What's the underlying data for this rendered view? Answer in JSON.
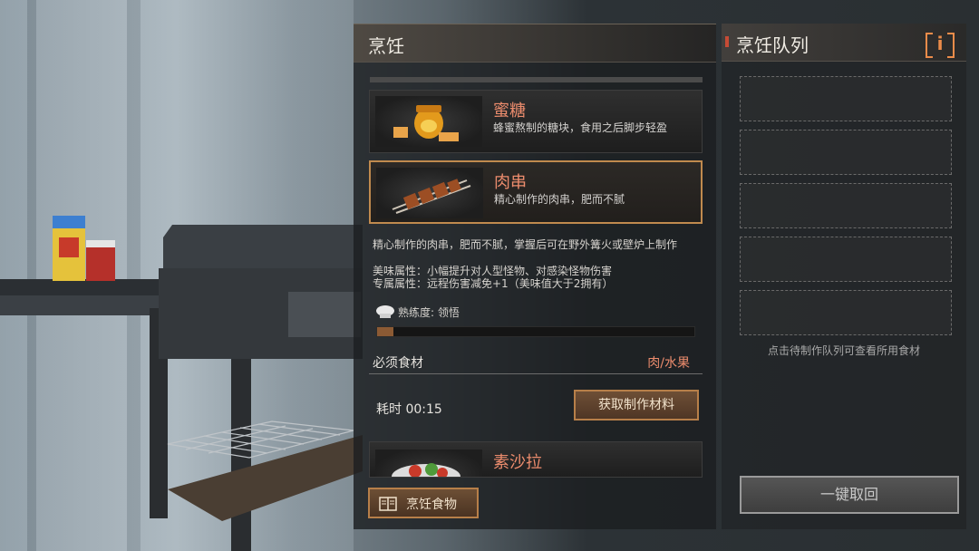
{
  "cooking": {
    "title": "烹饪",
    "recipes": [
      {
        "name": "蜜糖",
        "desc": "蜂蜜熬制的糖块，食用之后脚步轻盈",
        "icon": "honey-jar-icon"
      },
      {
        "name": "肉串",
        "desc": "精心制作的肉串，肥而不腻",
        "icon": "meat-skewer-icon",
        "selected": true
      },
      {
        "name": "素沙拉",
        "desc": "",
        "icon": "salad-bowl-icon"
      }
    ],
    "detail": {
      "long_desc": "精心制作的肉串，肥而不腻，掌握后可在野外篝火或壁炉上制作",
      "attr1": "美味属性：小幅提升对人型怪物、对感染怪物伤害",
      "attr2": "专属属性：远程伤害减免+1（美味值大于2拥有）",
      "proficiency": "熟练度: 领悟",
      "proficiency_progress": 0.05,
      "required_label": "必须食材",
      "required_value": "肉/水果",
      "time": "耗时 00:15",
      "get_button": "获取制作材料"
    },
    "cook_button": "烹饪食物"
  },
  "queue": {
    "title": "烹饪队列",
    "info_label": "i",
    "hint": "点击待制作队列可查看所用食材",
    "retrieve_button": "一键取回",
    "slot_count": 5
  },
  "colors": {
    "accent_text": "#ec8c6d",
    "button_border": "#b77f49",
    "info_orange": "#ec8c4a"
  }
}
